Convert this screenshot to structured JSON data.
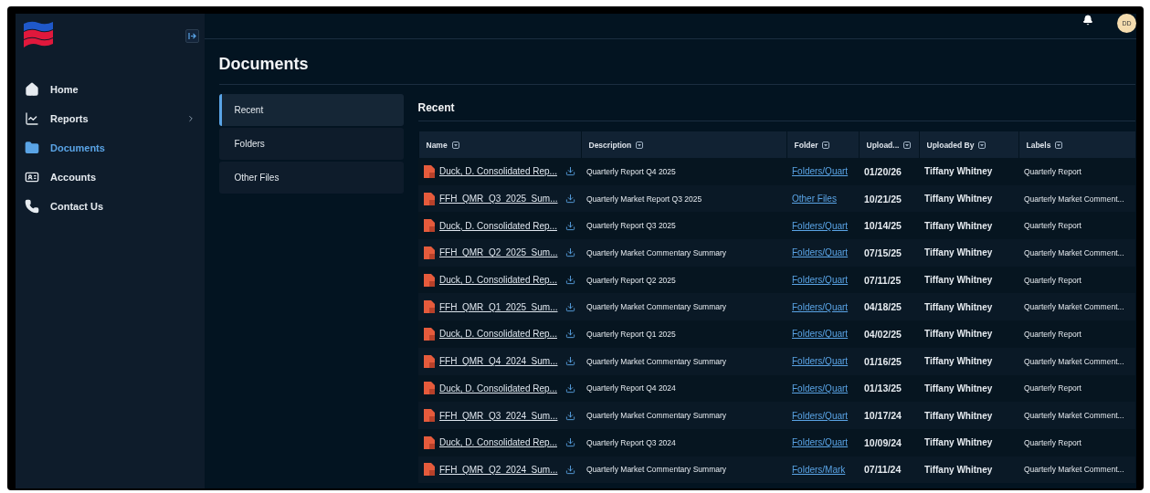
{
  "sidebar": {
    "items": [
      {
        "label": "Home",
        "selected": false,
        "has_submenu": false
      },
      {
        "label": "Reports",
        "selected": false,
        "has_submenu": true
      },
      {
        "label": "Documents",
        "selected": true,
        "has_submenu": false
      },
      {
        "label": "Accounts",
        "selected": false,
        "has_submenu": false
      },
      {
        "label": "Contact Us",
        "selected": false,
        "has_submenu": false
      }
    ]
  },
  "header": {
    "avatar": "DD"
  },
  "page": {
    "title": "Documents"
  },
  "subnav": {
    "items": [
      {
        "label": "Recent",
        "selected": true
      },
      {
        "label": "Folders",
        "selected": false
      },
      {
        "label": "Other Files",
        "selected": false
      }
    ]
  },
  "section": {
    "title": "Recent"
  },
  "table": {
    "columns": [
      "Name",
      "Description",
      "Folder",
      "Upload...",
      "Uploaded By",
      "Labels"
    ],
    "rows": [
      {
        "name": "Duck, D. Consolidated Rep...",
        "description": "Quarterly Report Q4 2025",
        "folder": "Folders/Quart",
        "uploaded": "01/20/26",
        "uploaded_by": "Tiffany Whitney",
        "labels": "Quarterly Report"
      },
      {
        "name": "FFH_QMR_Q3_2025_Sum...",
        "description": "Quarterly Market Report Q3 2025",
        "folder": "Other Files",
        "uploaded": "10/21/25",
        "uploaded_by": "Tiffany Whitney",
        "labels": "Quarterly Market Comment..."
      },
      {
        "name": "Duck, D. Consolidated Rep...",
        "description": "Quarterly Report Q3 2025",
        "folder": "Folders/Quart",
        "uploaded": "10/14/25",
        "uploaded_by": "Tiffany Whitney",
        "labels": "Quarterly Report"
      },
      {
        "name": "FFH_QMR_Q2_2025_Sum...",
        "description": "Quarterly Market Commentary Summary",
        "folder": "Folders/Quart",
        "uploaded": "07/15/25",
        "uploaded_by": "Tiffany Whitney",
        "labels": "Quarterly Market Comment..."
      },
      {
        "name": "Duck, D. Consolidated Rep...",
        "description": "Quarterly Report Q2 2025",
        "folder": "Folders/Quart",
        "uploaded": "07/11/25",
        "uploaded_by": "Tiffany Whitney",
        "labels": "Quarterly Report"
      },
      {
        "name": "FFH_QMR_Q1_2025_Sum...",
        "description": "Quarterly Market Commentary Summary",
        "folder": "Folders/Quart",
        "uploaded": "04/18/25",
        "uploaded_by": "Tiffany Whitney",
        "labels": "Quarterly Market Comment..."
      },
      {
        "name": "Duck, D. Consolidated Rep...",
        "description": "Quarterly Report Q1 2025",
        "folder": "Folders/Quart",
        "uploaded": "04/02/25",
        "uploaded_by": "Tiffany Whitney",
        "labels": "Quarterly Report"
      },
      {
        "name": "FFH_QMR_Q4_2024_Sum...",
        "description": "Quarterly Market Commentary Summary",
        "folder": "Folders/Quart",
        "uploaded": "01/16/25",
        "uploaded_by": "Tiffany Whitney",
        "labels": "Quarterly Market Comment..."
      },
      {
        "name": "Duck, D. Consolidated Rep...",
        "description": "Quarterly Report Q4 2024",
        "folder": "Folders/Quart",
        "uploaded": "01/13/25",
        "uploaded_by": "Tiffany Whitney",
        "labels": "Quarterly Report"
      },
      {
        "name": "FFH_QMR_Q3_2024_Sum...",
        "description": "Quarterly Market Commentary Summary",
        "folder": "Folders/Quart",
        "uploaded": "10/17/24",
        "uploaded_by": "Tiffany Whitney",
        "labels": "Quarterly Market Comment..."
      },
      {
        "name": "Duck, D. Consolidated Rep...",
        "description": "Quarterly Report Q3 2024",
        "folder": "Folders/Quart",
        "uploaded": "10/09/24",
        "uploaded_by": "Tiffany Whitney",
        "labels": "Quarterly Report"
      },
      {
        "name": "FFH_QMR_Q2_2024_Sum...",
        "description": "Quarterly Market Commentary Summary",
        "folder": "Folders/Mark",
        "uploaded": "07/11/24",
        "uploaded_by": "Tiffany Whitney",
        "labels": "Quarterly Market Comment..."
      }
    ]
  }
}
